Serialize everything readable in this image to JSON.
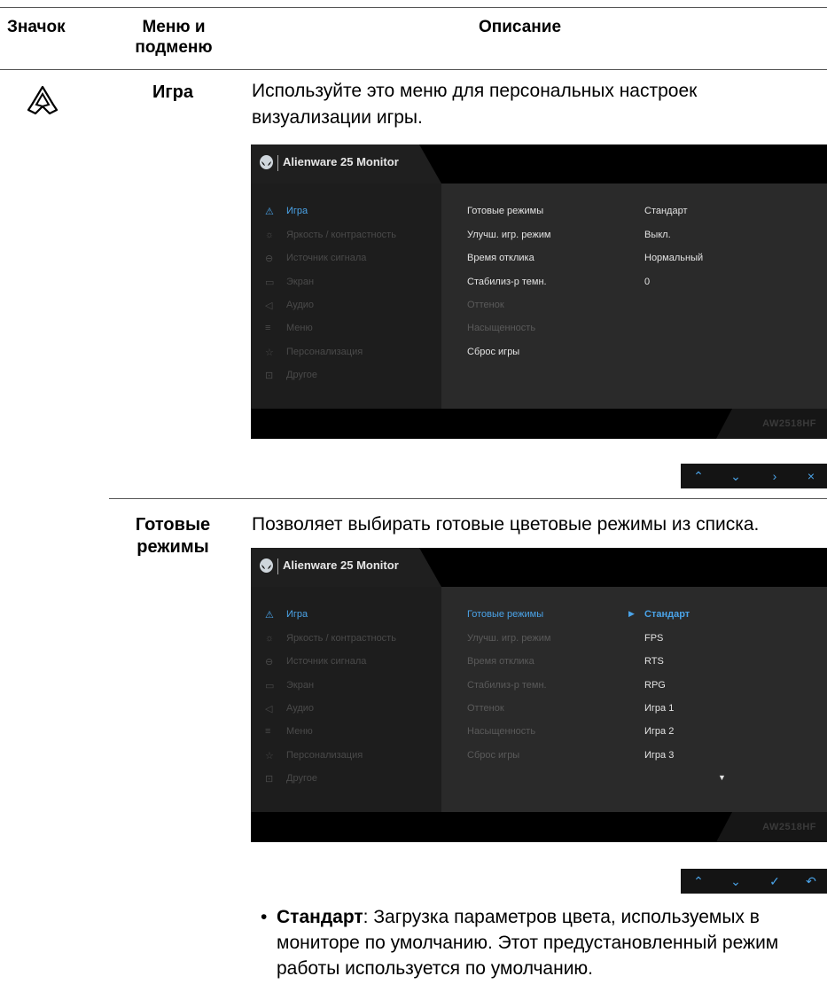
{
  "table_header": {
    "col_icon": "Значок",
    "col_menu": "Меню и\nподменю",
    "col_desc": "Описание"
  },
  "row1": {
    "menu": "Игра",
    "desc": "Используйте это меню для персональных настроек визуализации игры.",
    "icon": "game-icon"
  },
  "osd1": {
    "title": "Alienware 25 Monitor",
    "model": "AW2518HF",
    "menu_items": [
      {
        "label": "Игра",
        "icon": "game-icon"
      },
      {
        "label": "Яркость / контрастность",
        "icon": "brightness-icon"
      },
      {
        "label": "Источник сигнала",
        "icon": "input-icon"
      },
      {
        "label": "Экран",
        "icon": "display-icon"
      },
      {
        "label": "Аудио",
        "icon": "audio-icon"
      },
      {
        "label": "Меню",
        "icon": "menu-icon"
      },
      {
        "label": "Персонализация",
        "icon": "star-icon"
      },
      {
        "label": "Другое",
        "icon": "other-icon"
      }
    ],
    "options": [
      "Готовые режимы",
      "Улучш. игр. режим",
      "Время отклика",
      "Стабилиз-р темн.",
      "Оттенок",
      "Насыщенность",
      "Сброс игры"
    ],
    "values": [
      "Стандарт",
      "Выкл.",
      "Нормальный",
      "0"
    ],
    "nav": [
      "up",
      "down",
      "right",
      "close"
    ]
  },
  "row2": {
    "menu": "Готовые\nрежимы",
    "desc": "Позволяет выбирать готовые цветовые режимы из списка."
  },
  "osd2": {
    "title": "Alienware 25 Monitor",
    "model": "AW2518HF",
    "values": [
      "Стандарт",
      "FPS",
      "RTS",
      "RPG",
      "Игра 1",
      "Игра 2",
      "Игра 3"
    ],
    "nav": [
      "up",
      "down",
      "check",
      "back"
    ]
  },
  "bullet": {
    "term": "Стандарт",
    "text": ": Загрузка параметров цвета, используемых в мониторе по умолчанию. Этот предустановленный режим работы используется по умолчанию."
  }
}
